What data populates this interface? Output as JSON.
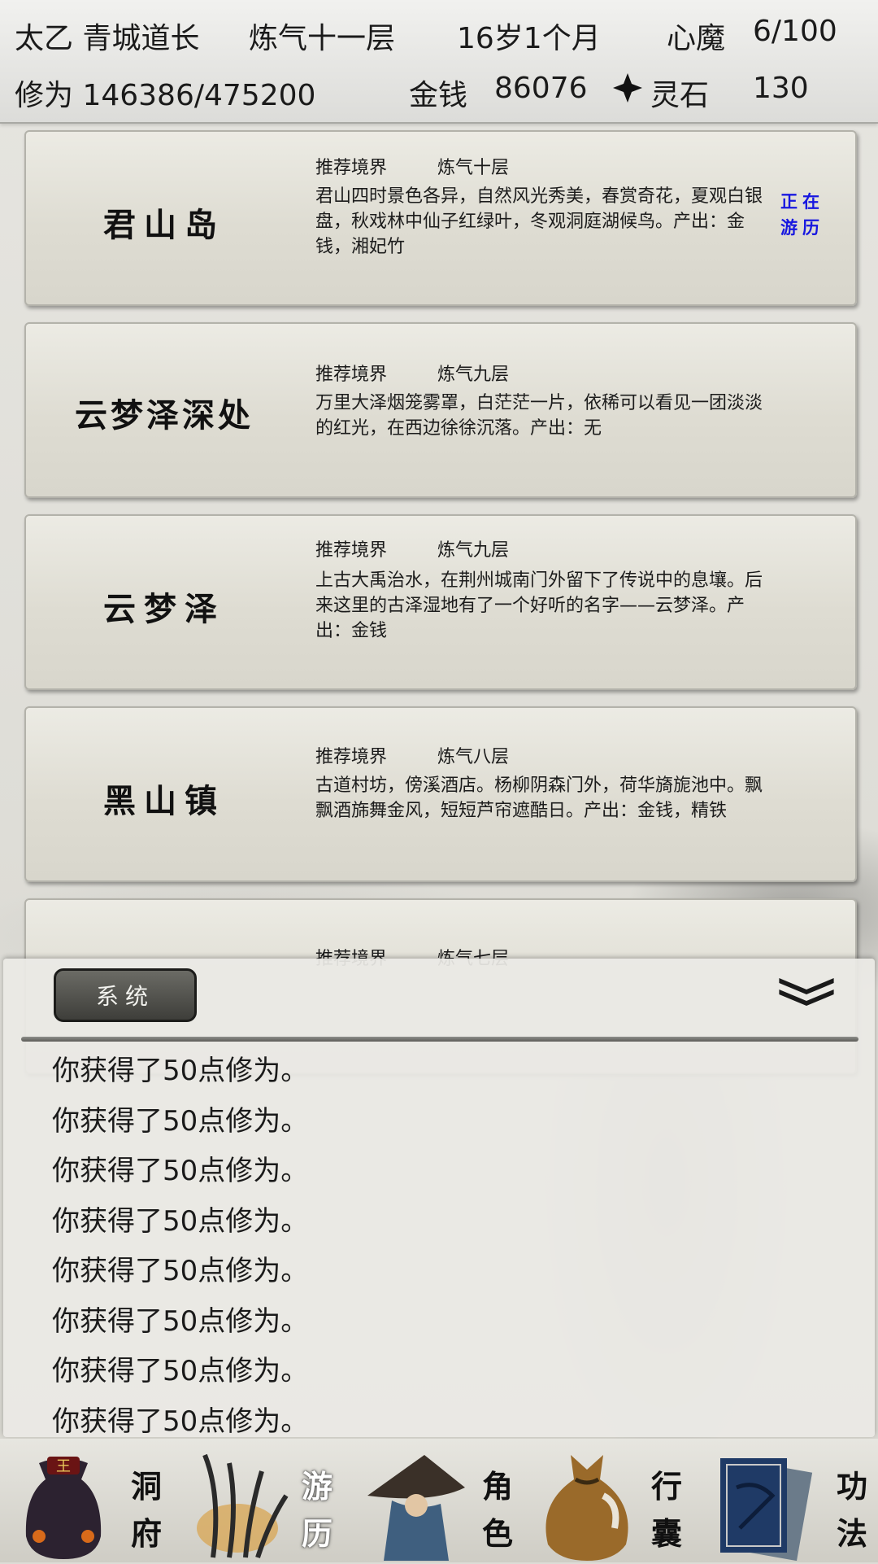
{
  "header": {
    "name": "太乙 青城道长",
    "realm": "炼气十一层",
    "age": "16岁1个月",
    "xinmo_label": "心魔",
    "xinmo_value": "6/100",
    "xiuwei": "修为 146386/475200",
    "gold_label": "金钱",
    "gold_value": "86076",
    "stone_label": "灵石",
    "stone_value": "130"
  },
  "locations": [
    {
      "name": "君山岛",
      "rec_label": "推荐境界",
      "rec_value": "炼气十层",
      "desc": "君山四时景色各异，自然风光秀美，春赏奇花，夏观白银盘，秋戏林中仙子红绿叶，冬观洞庭湖候鸟。产出：金钱，湘妃竹",
      "status": "正在游历"
    },
    {
      "name": "云梦泽深处",
      "rec_label": "推荐境界",
      "rec_value": "炼气九层",
      "desc": "万里大泽烟笼雾罩，白茫茫一片，依稀可以看见一团淡淡的红光，在西边徐徐沉落。产出：无"
    },
    {
      "name": "云梦泽",
      "rec_label": "推荐境界",
      "rec_value": "炼气九层",
      "desc": "上古大禹治水，在荆州城南门外留下了传说中的息壤。后来这里的古泽湿地有了一个好听的名字——云梦泽。产出：金钱"
    },
    {
      "name": "黑山镇",
      "rec_label": "推荐境界",
      "rec_value": "炼气八层",
      "desc": "古道村坊，傍溪酒店。杨柳阴森门外，荷华旖旎池中。飘飘酒旆舞金风，短短芦帘遮酷日。产出：金钱，精铁"
    },
    {
      "name": "",
      "rec_label": "推荐境界",
      "rec_value": "炼气七层",
      "desc": ""
    }
  ],
  "log": {
    "tab_label": "系统",
    "lines": [
      "你获得了50点修为。",
      "你获得了50点修为。",
      "你获得了50点修为。",
      "你获得了50点修为。",
      "你获得了50点修为。",
      "你获得了50点修为。",
      "你获得了50点修为。",
      "你获得了50点修为。"
    ]
  },
  "nav": {
    "dongfu": "洞府",
    "youli": "游历",
    "jiaose": "角色",
    "xingnang": "行囊",
    "gongfa": "功法"
  },
  "colors": {
    "status_text": "#1717e0",
    "active_nav": "#ffffff"
  }
}
